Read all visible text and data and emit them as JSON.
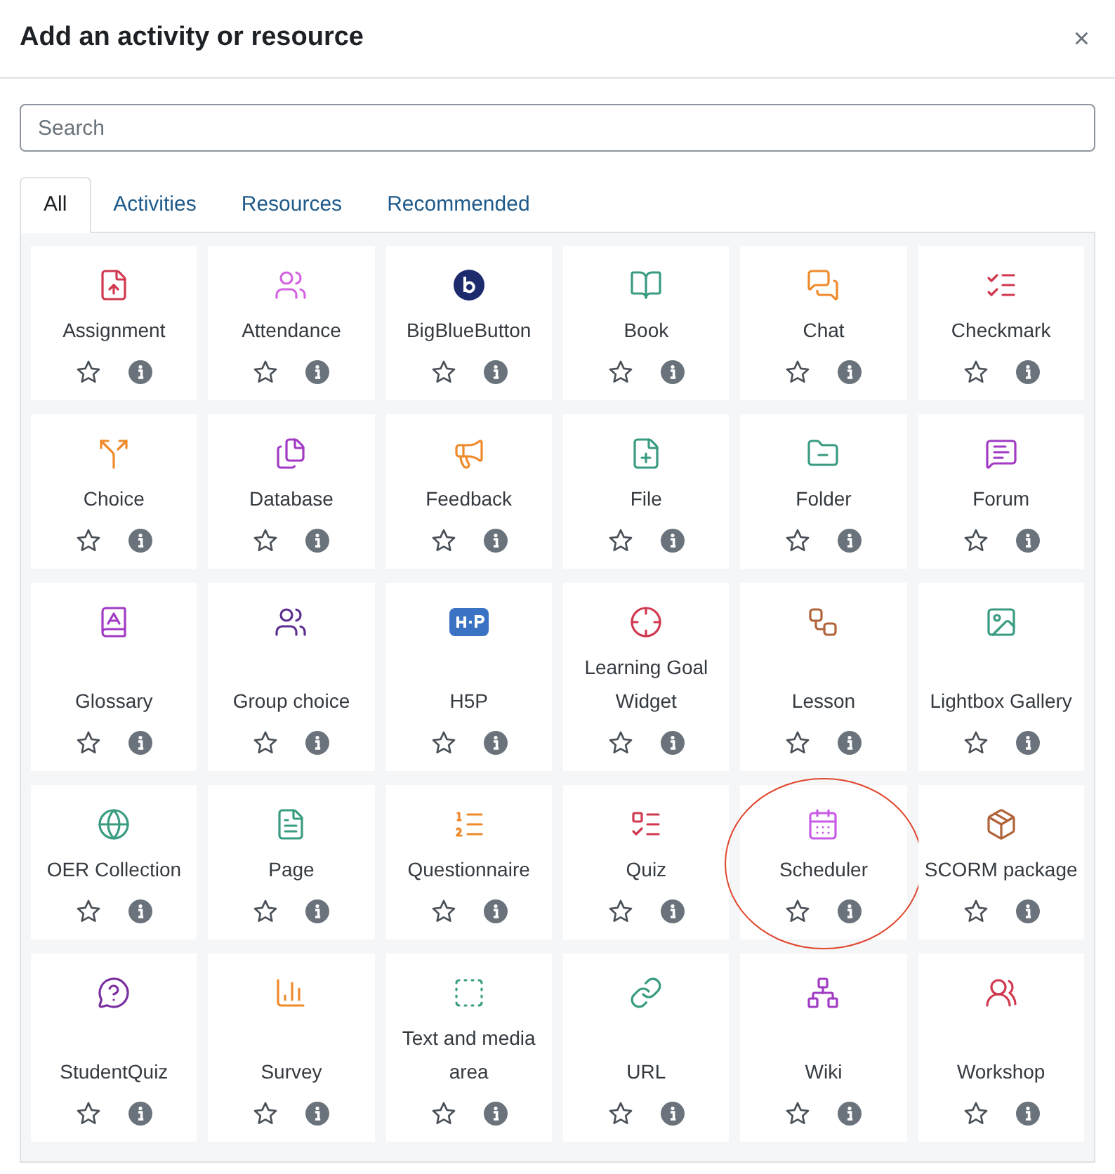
{
  "dialog": {
    "title": "Add an activity or resource",
    "close": "×"
  },
  "search": {
    "placeholder": "Search"
  },
  "tabs": [
    {
      "label": "All",
      "selected": true
    },
    {
      "label": "Activities",
      "selected": false
    },
    {
      "label": "Resources",
      "selected": false
    },
    {
      "label": "Recommended",
      "selected": false
    }
  ],
  "items": [
    {
      "label": "Assignment",
      "highlighted": false
    },
    {
      "label": "Attendance",
      "highlighted": false
    },
    {
      "label": "BigBlueButton",
      "highlighted": false
    },
    {
      "label": "Book",
      "highlighted": false
    },
    {
      "label": "Chat",
      "highlighted": false
    },
    {
      "label": "Checkmark",
      "highlighted": false
    },
    {
      "label": "Choice",
      "highlighted": false
    },
    {
      "label": "Database",
      "highlighted": false
    },
    {
      "label": "Feedback",
      "highlighted": false
    },
    {
      "label": "File",
      "highlighted": false
    },
    {
      "label": "Folder",
      "highlighted": false
    },
    {
      "label": "Forum",
      "highlighted": false
    },
    {
      "label": "Glossary",
      "highlighted": false
    },
    {
      "label": "Group choice",
      "highlighted": false
    },
    {
      "label": "H5P",
      "highlighted": false
    },
    {
      "label": "Learning Goal Widget",
      "highlighted": false
    },
    {
      "label": "Lesson",
      "highlighted": false
    },
    {
      "label": "Lightbox Gallery",
      "highlighted": false
    },
    {
      "label": "OER Collection",
      "highlighted": false
    },
    {
      "label": "Page",
      "highlighted": false
    },
    {
      "label": "Questionnaire",
      "highlighted": false
    },
    {
      "label": "Quiz",
      "highlighted": false
    },
    {
      "label": "Scheduler",
      "highlighted": true
    },
    {
      "label": "SCORM package",
      "highlighted": false
    },
    {
      "label": "StudentQuiz",
      "highlighted": false
    },
    {
      "label": "Survey",
      "highlighted": false
    },
    {
      "label": "Text and media area",
      "highlighted": false
    },
    {
      "label": "URL",
      "highlighted": false
    },
    {
      "label": "Wiki",
      "highlighted": false
    },
    {
      "label": "Workshop",
      "highlighted": false
    }
  ]
}
